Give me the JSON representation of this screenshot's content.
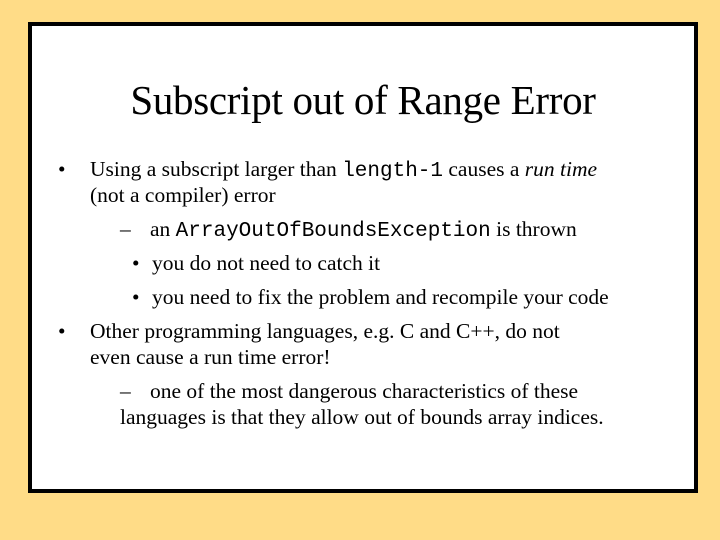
{
  "slide": {
    "title": "Subscript out of Range Error",
    "bullets": {
      "b1": {
        "marker": "•",
        "line1": {
          "pre": "Using a subscript larger than ",
          "code": "length-1",
          "mid": " causes a ",
          "em": "run time",
          "post": ""
        },
        "line2": "(not a compiler) error",
        "sub1": {
          "marker": "–",
          "pre": "an ",
          "code": "ArrayOutOfBoundsException",
          "post": " is thrown",
          "subsub": [
            {
              "marker": "•",
              "text": "you do not need to catch it"
            },
            {
              "marker": "•",
              "text": "you need to fix the problem and recompile your code"
            }
          ]
        }
      },
      "b2": {
        "marker": "•",
        "line1": "Other programming languages, e.g. C and C++, do not",
        "line2": "even cause a run time error!",
        "sub1": {
          "marker": "–",
          "line1": "one of the most dangerous characteristics of these",
          "line2": "languages is that they allow out of bounds array indices."
        }
      }
    }
  },
  "colors": {
    "background": "#FFDC87",
    "frame_fill": "#FFFFFF",
    "frame_border": "#000000",
    "text": "#000000"
  }
}
